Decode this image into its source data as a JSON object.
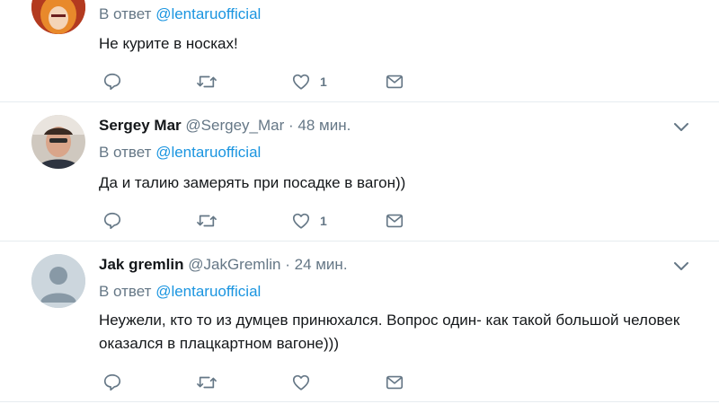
{
  "colors": {
    "name": "#14171a",
    "muted": "#657786",
    "link": "#1b95e0",
    "divider": "#e6ecf0"
  },
  "tweets": [
    {
      "reply_prefix": "В ответ",
      "reply_mention": "@lentaruofficial",
      "text": "Не курите в носках!",
      "like_count": "1",
      "avatar_icon": "avatar-orange-hair"
    },
    {
      "name": "Sergey Mar",
      "handle": "@Sergey_Mar",
      "separator": "·",
      "time": "48 мин.",
      "reply_prefix": "В ответ",
      "reply_mention": "@lentaruofficial",
      "text": "Да и талию замерять при посадке в вагон))",
      "like_count": "1",
      "avatar_icon": "avatar-photo"
    },
    {
      "name": "Jak gremlin",
      "handle": "@JakGremlin",
      "separator": "·",
      "time": "24 мин.",
      "reply_prefix": "В ответ",
      "reply_mention": "@lentaruofficial",
      "text": "Неужели, кто то из думцев принюхался. Вопрос один- как такой большой человек оказался в плацкартном вагоне)))",
      "like_count": "",
      "avatar_icon": "default-avatar-icon"
    }
  ]
}
